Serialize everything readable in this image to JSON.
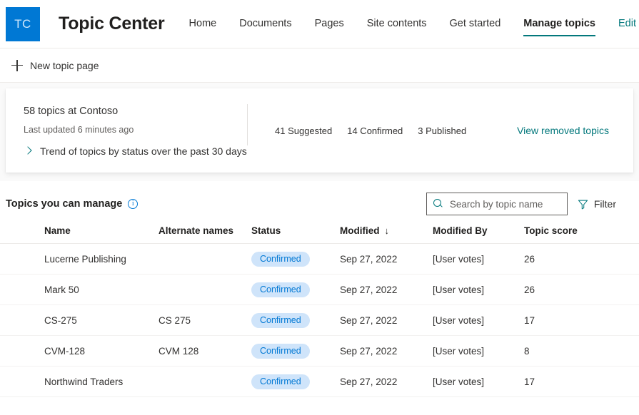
{
  "site": {
    "logo_initials": "TC",
    "title": "Topic Center",
    "nav": [
      {
        "label": "Home",
        "state": "normal"
      },
      {
        "label": "Documents",
        "state": "normal"
      },
      {
        "label": "Pages",
        "state": "normal"
      },
      {
        "label": "Site contents",
        "state": "normal"
      },
      {
        "label": "Get started",
        "state": "normal"
      },
      {
        "label": "Manage topics",
        "state": "selected"
      },
      {
        "label": "Edit",
        "state": "accent"
      }
    ]
  },
  "command_bar": {
    "new_topic_page": "New topic page",
    "add_icon": "plus-icon"
  },
  "summary_card": {
    "topic_count_text": "58 topics at Contoso",
    "last_updated": "Last updated 6 minutes ago",
    "trend_label": "Trend of topics by status over the past 30 days",
    "trend_icon": "chevron-right-icon",
    "stats": [
      {
        "label": "41 Suggested"
      },
      {
        "label": "14 Confirmed"
      },
      {
        "label": "3 Published"
      }
    ],
    "view_removed_link": "View removed topics"
  },
  "list": {
    "title": "Topics you can manage",
    "info_icon": "info-icon",
    "info_glyph": "i",
    "search": {
      "placeholder": "Search by topic name",
      "value": "",
      "icon": "search-icon"
    },
    "filter": {
      "label": "Filter",
      "icon": "filter-funnel-icon"
    },
    "columns": [
      {
        "label": "Name"
      },
      {
        "label": "Alternate names"
      },
      {
        "label": "Status"
      },
      {
        "label": "Modified",
        "sort": "↓"
      },
      {
        "label": "Modified By"
      },
      {
        "label": "Topic score"
      }
    ],
    "rows": [
      {
        "name": "Lucerne Publishing",
        "alternate": "",
        "status": "Confirmed",
        "modified": "Sep 27, 2022",
        "modified_by": "[User votes]",
        "score": "26"
      },
      {
        "name": "Mark 50",
        "alternate": "",
        "status": "Confirmed",
        "modified": "Sep 27, 2022",
        "modified_by": "[User votes]",
        "score": "26"
      },
      {
        "name": "CS-275",
        "alternate": "CS 275",
        "status": "Confirmed",
        "modified": "Sep 27, 2022",
        "modified_by": "[User votes]",
        "score": "17"
      },
      {
        "name": "CVM-128",
        "alternate": "CVM 128",
        "status": "Confirmed",
        "modified": "Sep 27, 2022",
        "modified_by": "[User votes]",
        "score": "8"
      },
      {
        "name": "Northwind Traders",
        "alternate": "",
        "status": "Confirmed",
        "modified": "Sep 27, 2022",
        "modified_by": "[User votes]",
        "score": "17"
      }
    ]
  },
  "colors": {
    "brand_blue": "#0078d4",
    "accent_teal": "#03787c",
    "badge_bg": "#cfe4fa",
    "badge_text": "#0078d4",
    "page_bg": "#ffffff",
    "card_zone_bg": "#fafafa"
  }
}
